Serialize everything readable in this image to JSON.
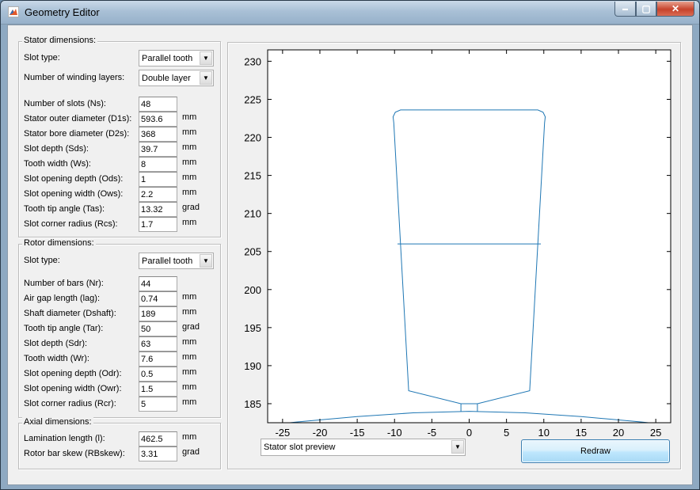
{
  "window": {
    "title": "Geometry Editor",
    "close_glyph": "✕",
    "minimize_glyph": "▬",
    "maximize_glyph": "▢"
  },
  "stator": {
    "title": "Stator dimensions:",
    "slot_type_label": "Slot type:",
    "slot_type_value": "Parallel tooth",
    "layers_label": "Number of winding layers:",
    "layers_value": "Double layer",
    "fields": [
      {
        "label": "Number of slots (Ns):",
        "value": "48",
        "unit": ""
      },
      {
        "label": "Stator outer diameter (D1s):",
        "value": "593.6",
        "unit": "mm"
      },
      {
        "label": "Stator bore diameter (D2s):",
        "value": "368",
        "unit": "mm"
      },
      {
        "label": "Slot depth (Sds):",
        "value": "39.7",
        "unit": "mm"
      },
      {
        "label": "Tooth width (Ws):",
        "value": "8",
        "unit": "mm"
      },
      {
        "label": "Slot opening depth (Ods):",
        "value": "1",
        "unit": "mm"
      },
      {
        "label": "Slot opening width (Ows):",
        "value": "2.2",
        "unit": "mm"
      },
      {
        "label": "Tooth tip angle (Tas):",
        "value": "13.32",
        "unit": "grad"
      },
      {
        "label": "Slot corner radius (Rcs):",
        "value": "1.7",
        "unit": "mm"
      }
    ]
  },
  "rotor": {
    "title": "Rotor dimensions:",
    "slot_type_label": "Slot type:",
    "slot_type_value": "Parallel tooth",
    "fields": [
      {
        "label": "Number of bars (Nr):",
        "value": "44",
        "unit": ""
      },
      {
        "label": "Air gap length (lag):",
        "value": "0.74",
        "unit": "mm"
      },
      {
        "label": "Shaft diameter (Dshaft):",
        "value": "189",
        "unit": "mm"
      },
      {
        "label": "Tooth tip angle (Tar):",
        "value": "50",
        "unit": "grad"
      },
      {
        "label": "Slot depth (Sdr):",
        "value": "63",
        "unit": "mm"
      },
      {
        "label": "Tooth width (Wr):",
        "value": "7.6",
        "unit": "mm"
      },
      {
        "label": "Slot opening depth (Odr):",
        "value": "0.5",
        "unit": "mm"
      },
      {
        "label": "Slot opening width (Owr):",
        "value": "1.5",
        "unit": "mm"
      },
      {
        "label": "Slot corner radius (Rcr):",
        "value": "5",
        "unit": "mm"
      }
    ]
  },
  "axial": {
    "title": "Axial dimensions:",
    "fields": [
      {
        "label": "Lamination length (l):",
        "value": "462.5",
        "unit": "mm"
      },
      {
        "label": "Rotor bar skew (RBskew):",
        "value": "3.31",
        "unit": "grad"
      }
    ]
  },
  "preview": {
    "selector_value": "Stator slot preview",
    "redraw_label": "Redraw"
  },
  "colors": {
    "line": "#1f77b4"
  },
  "chart_data": {
    "type": "line",
    "title": "",
    "xlabel": "",
    "ylabel": "",
    "xlim": [
      -27,
      27
    ],
    "ylim": [
      182.5,
      231.5
    ],
    "xticks": [
      -25,
      -20,
      -15,
      -10,
      -5,
      0,
      5,
      10,
      15,
      20,
      25
    ],
    "yticks": [
      185,
      190,
      195,
      200,
      205,
      210,
      215,
      220,
      225,
      230
    ],
    "grid": false,
    "series": [
      {
        "points": [
          [
            -1.1,
            184.0
          ],
          [
            -1.1,
            185.0
          ],
          [
            -8.1,
            186.7
          ],
          [
            -10.1,
            221.9
          ],
          [
            -10.2,
            222.7
          ],
          [
            -9.9,
            223.3
          ],
          [
            -9.2,
            223.6
          ],
          [
            9.2,
            223.6
          ],
          [
            9.9,
            223.3
          ],
          [
            10.2,
            222.7
          ],
          [
            10.1,
            221.9
          ],
          [
            8.1,
            186.7
          ],
          [
            1.1,
            185.0
          ],
          [
            1.1,
            184.0
          ]
        ]
      },
      {
        "points": [
          [
            -1.1,
            185.0
          ],
          [
            1.1,
            185.0
          ]
        ]
      },
      {
        "points": [
          [
            -9.6,
            206.0
          ],
          [
            9.6,
            206.0
          ]
        ]
      },
      {
        "points": [
          [
            -27,
            182.2
          ],
          [
            -23.0,
            182.6
          ],
          [
            -15.0,
            183.3
          ],
          [
            -7.5,
            183.8
          ],
          [
            0,
            184.0
          ],
          [
            7.5,
            183.8
          ],
          [
            15.0,
            183.3
          ],
          [
            23.0,
            182.6
          ],
          [
            27,
            182.2
          ]
        ]
      }
    ]
  }
}
